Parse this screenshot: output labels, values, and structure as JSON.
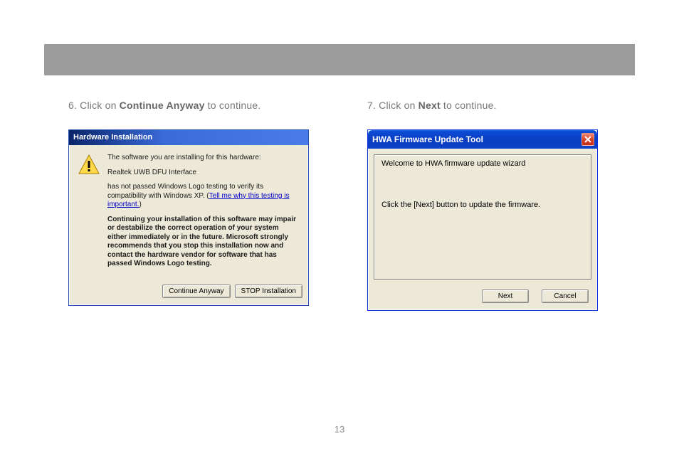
{
  "header_bar": "",
  "steps": {
    "left": {
      "number": "6.",
      "pre": "Click on ",
      "bold": "Continue Anyway",
      "post": " to continue."
    },
    "right": {
      "number": "7.",
      "pre": "Click on ",
      "bold": "Next",
      "post": " to continue."
    }
  },
  "dialog1": {
    "title": "Hardware Installation",
    "line1": "The software you are installing for this hardware:",
    "device": "Realtek UWB DFU Interface",
    "line2a": "has not passed Windows Logo testing to verify its compatibility with Windows XP. (",
    "link": "Tell me why this testing is important.",
    "line2b": ")",
    "bold_para": "Continuing your installation of this software may impair or destabilize the correct operation of your system either immediately or in the future. Microsoft strongly recommends that you stop this installation now and contact the hardware vendor for software that has passed Windows Logo testing.",
    "buttons": {
      "continue": "Continue Anyway",
      "stop": "STOP Installation"
    }
  },
  "dialog2": {
    "title": "HWA Firmware Update Tool",
    "welcome": "Welcome to HWA firmware update wizard",
    "instruction": "Click the [Next] button to update the firmware.",
    "buttons": {
      "next": "Next",
      "cancel": "Cancel"
    }
  },
  "page_number": "13"
}
